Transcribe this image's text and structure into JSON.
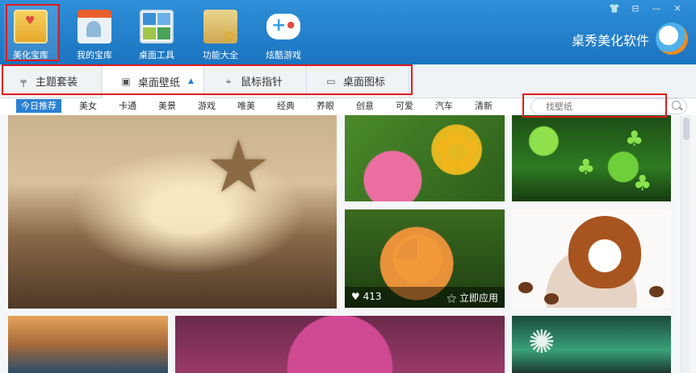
{
  "app": {
    "brand_name": "桌秀美化软件"
  },
  "toolbar": {
    "items": [
      {
        "label": "美化宝库",
        "icon": "treasure-box-icon"
      },
      {
        "label": "我的宝库",
        "icon": "my-store-icon"
      },
      {
        "label": "桌面工具",
        "icon": "desktop-tools-icon"
      },
      {
        "label": "功能大全",
        "icon": "toolbox-folder-icon"
      },
      {
        "label": "炫酷游戏",
        "icon": "gamepad-icon"
      }
    ]
  },
  "window_controls": {
    "skin": "👕",
    "menu": "⊟",
    "minimize": "—",
    "close": "✕"
  },
  "category_tabs": [
    {
      "label": "主题套装",
      "icon": "brush-icon"
    },
    {
      "label": "桌面壁纸",
      "icon": "wallpaper-image-icon"
    },
    {
      "label": "鼠标指针",
      "icon": "mouse-icon"
    },
    {
      "label": "桌面图标",
      "icon": "monitor-icon"
    }
  ],
  "filters": [
    "今日推荐",
    "美女",
    "卡通",
    "美景",
    "游戏",
    "唯美",
    "经典",
    "养眼",
    "创意",
    "可爱",
    "汽车",
    "清新"
  ],
  "search": {
    "placeholder": "找壁纸"
  },
  "gallery": {
    "hover_tile": {
      "likes": "413",
      "apply_label": "立即应用"
    }
  },
  "colors": {
    "accent": "#2a80d2",
    "toolbar_bg": "#1b74c0",
    "annotation_red": "#e21b1b"
  }
}
